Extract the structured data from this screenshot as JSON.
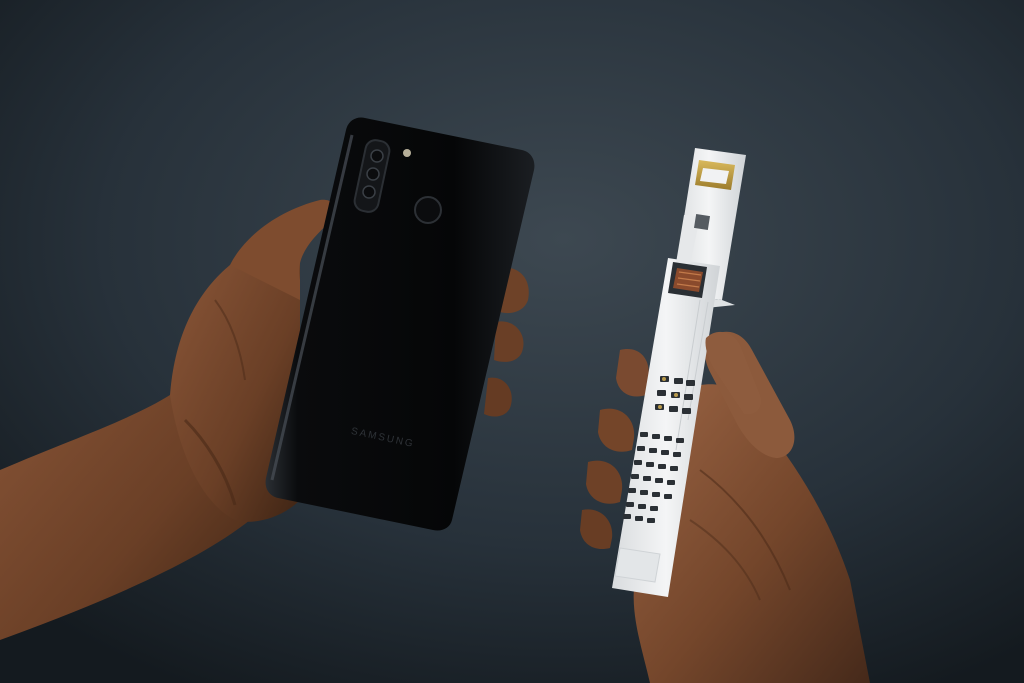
{
  "photo": {
    "phone_brand_text": "SAMSUNG",
    "colors": {
      "background": "#222a31",
      "background_light": "#3a454e",
      "skin": "#7a4a30",
      "skin_shadow": "#4a2a18",
      "phone_body": "#07080a",
      "pcb": "#eef0f1",
      "gold_pad": "#c8a64a"
    }
  }
}
